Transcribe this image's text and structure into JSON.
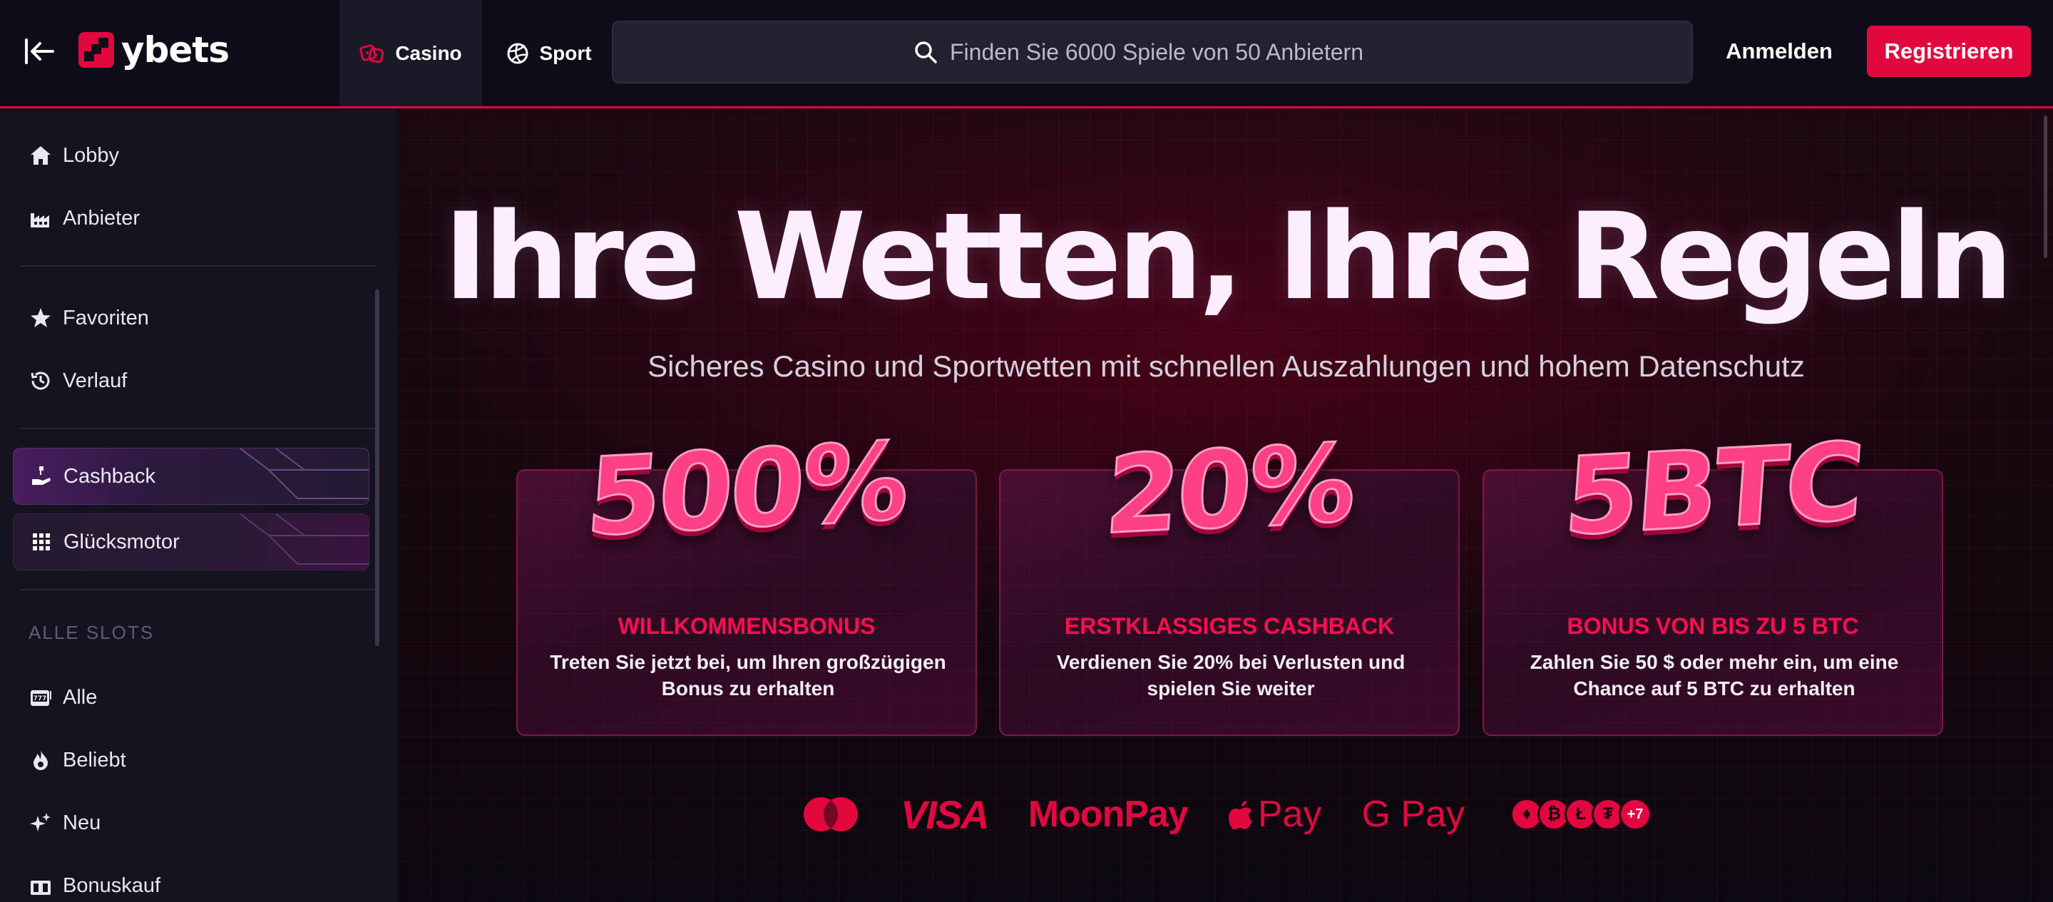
{
  "header": {
    "brand": "ybets",
    "tabs": [
      {
        "label": "Casino",
        "icon": "dice-icon",
        "active": true
      },
      {
        "label": "Sport",
        "icon": "volleyball-icon",
        "active": false
      }
    ],
    "search_placeholder": "Finden Sie 6000 Spiele von 50 Anbietern",
    "login_label": "Anmelden",
    "register_label": "Registrieren"
  },
  "sidebar": {
    "items": [
      {
        "label": "Lobby",
        "icon": "home-icon"
      },
      {
        "label": "Anbieter",
        "icon": "factory-icon"
      },
      {
        "label": "Favoriten",
        "icon": "star-icon"
      },
      {
        "label": "Verlauf",
        "icon": "history-icon"
      }
    ],
    "promos": [
      {
        "label": "Cashback",
        "icon": "cashback-hand-icon"
      },
      {
        "label": "Glücksmotor",
        "icon": "grid-icon"
      }
    ],
    "section_label": "ALLE SLOTS",
    "slots": [
      {
        "label": "Alle",
        "icon": "slot-machine-icon"
      },
      {
        "label": "Beliebt",
        "icon": "fire-icon"
      },
      {
        "label": "Neu",
        "icon": "sparkle-icon"
      },
      {
        "label": "Bonuskauf",
        "icon": "gift-box-icon"
      }
    ]
  },
  "hero": {
    "title": "Ihre Wetten, Ihre Regeln",
    "subtitle": "Sicheres Casino und Sportwetten mit schnellen Auszahlungen und hohem Datenschutz"
  },
  "cards": [
    {
      "big": "500%",
      "title": "WILLKOMMENSBONUS",
      "desc": "Treten Sie jetzt bei, um Ihren großzügigen Bonus zu erhalten"
    },
    {
      "big": "20%",
      "title": "ERSTKLASSIGES CASHBACK",
      "desc": "Verdienen Sie 20% bei Verlusten und spielen Sie weiter"
    },
    {
      "big": "5BTC",
      "title": "BONUS VON BIS ZU 5 BTC",
      "desc": "Zahlen Sie 50 $ oder mehr ein, um eine Chance auf 5 BTC zu erhalten"
    }
  ],
  "payments": {
    "visa": "VISA",
    "moonpay": "MoonPay",
    "apple_pay": "Pay",
    "google_pay": "G Pay",
    "coins": [
      "♦",
      "₿",
      "Ł",
      "₮"
    ],
    "more": "+7"
  },
  "colors": {
    "accent": "#e2073f",
    "background": "#0a0912",
    "sidebar": "#14131f"
  }
}
